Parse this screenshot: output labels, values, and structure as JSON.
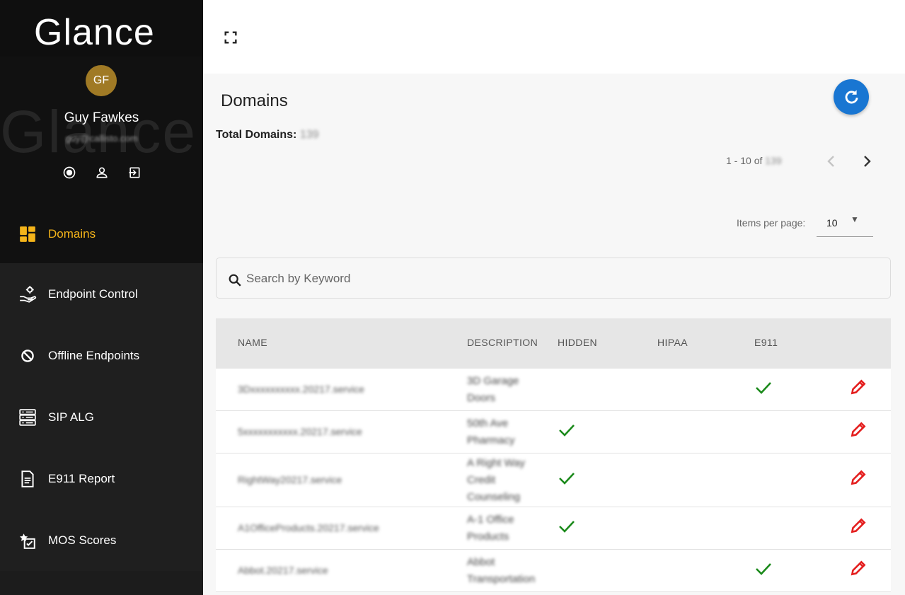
{
  "app": {
    "logo": "Glance",
    "watermark": "Glance"
  },
  "user": {
    "initials": "GF",
    "name": "Guy Fawkes",
    "email": "guy@callisto.com"
  },
  "profile_actions": [
    "status-icon",
    "profile-icon",
    "logout-icon"
  ],
  "nav": [
    {
      "label": "Domains",
      "icon": "dashboard-icon",
      "active": true
    },
    {
      "label": "Endpoint Control",
      "icon": "hand-gear-icon",
      "active": false
    },
    {
      "label": "Offline Endpoints",
      "icon": "block-icon",
      "active": false
    },
    {
      "label": "SIP ALG",
      "icon": "server-icon",
      "active": false
    },
    {
      "label": "E911 Report",
      "icon": "document-icon",
      "active": false
    },
    {
      "label": "MOS Scores",
      "icon": "rating-icon",
      "active": false
    }
  ],
  "page": {
    "title": "Domains",
    "total_label": "Total Domains:",
    "total_value": "139",
    "range_label": "1 - 10 of",
    "range_total": "139",
    "items_per_page_label": "Items per page:",
    "items_per_page": "10",
    "search_placeholder": "Search by Keyword"
  },
  "table": {
    "columns": {
      "name": "NAME",
      "description": "DESCRIPTION",
      "hidden": "HIDDEN",
      "hipaa": "HIPAA",
      "e911": "E911"
    },
    "rows": [
      {
        "name": "3Dxxxxxxxxxx.20217.service",
        "desc": [
          "3D Garage",
          "Doors"
        ],
        "hidden": false,
        "hipaa": false,
        "e911": true
      },
      {
        "name": "5xxxxxxxxxxx.20217.service",
        "desc": [
          "50th Ave",
          "Pharmacy"
        ],
        "hidden": true,
        "hipaa": false,
        "e911": false
      },
      {
        "name": "RightWay20217.service",
        "desc": [
          "A Right Way",
          "Credit",
          "Counseling"
        ],
        "hidden": true,
        "hipaa": false,
        "e911": false
      },
      {
        "name": "A1OfficeProducts.20217.service",
        "desc": [
          "A-1 Office",
          "Products"
        ],
        "hidden": true,
        "hipaa": false,
        "e911": false
      },
      {
        "name": "Abbot.20217.service",
        "desc": [
          "Abbot",
          "Transportation"
        ],
        "hidden": false,
        "hipaa": false,
        "e911": true
      }
    ]
  },
  "colors": {
    "accent": "#f4b41a",
    "refresh": "#1976d2",
    "check": "#1b8a1b",
    "edit": "#e41e1e"
  }
}
